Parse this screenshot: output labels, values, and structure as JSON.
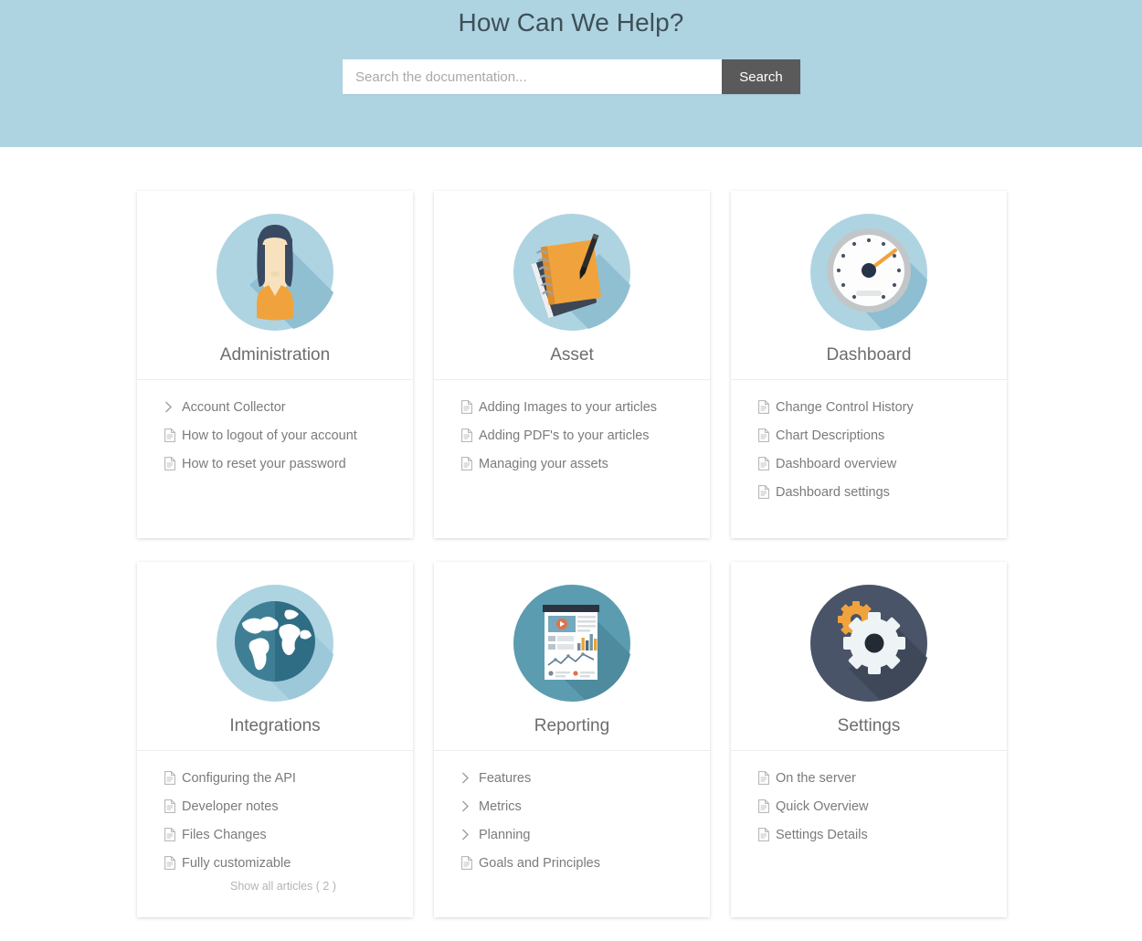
{
  "hero": {
    "title": "How Can We Help?",
    "background_color": "#aed4e2",
    "search": {
      "placeholder": "Search the documentation...",
      "value": "",
      "button_label": "Search",
      "button_color": "#5a5a5a"
    }
  },
  "cards": [
    {
      "title": "Administration",
      "icon": "avatar-person-icon",
      "items": [
        {
          "type": "category",
          "icon": "chevron-right-icon",
          "label": "Account Collector"
        },
        {
          "type": "article",
          "icon": "document-icon",
          "label": "How to logout of your account"
        },
        {
          "type": "article",
          "icon": "document-icon",
          "label": "How to reset your password"
        }
      ],
      "show_all": null
    },
    {
      "title": "Asset",
      "icon": "notebook-pen-icon",
      "items": [
        {
          "type": "article",
          "icon": "document-icon",
          "label": "Adding Images to your articles"
        },
        {
          "type": "article",
          "icon": "document-icon",
          "label": "Adding PDF's to your articles"
        },
        {
          "type": "article",
          "icon": "document-icon",
          "label": "Managing your assets"
        }
      ],
      "show_all": null
    },
    {
      "title": "Dashboard",
      "icon": "gauge-icon",
      "items": [
        {
          "type": "article",
          "icon": "document-icon",
          "label": "Change Control History"
        },
        {
          "type": "article",
          "icon": "document-icon",
          "label": "Chart Descriptions"
        },
        {
          "type": "article",
          "icon": "document-icon",
          "label": "Dashboard overview"
        },
        {
          "type": "article",
          "icon": "document-icon",
          "label": "Dashboard settings"
        }
      ],
      "show_all": null
    },
    {
      "title": "Integrations",
      "icon": "globe-icon",
      "items": [
        {
          "type": "article",
          "icon": "document-icon",
          "label": "Configuring the API"
        },
        {
          "type": "article",
          "icon": "document-icon",
          "label": "Developer notes"
        },
        {
          "type": "article",
          "icon": "document-icon",
          "label": "Files Changes"
        },
        {
          "type": "article",
          "icon": "document-icon",
          "label": "Fully customizable"
        }
      ],
      "show_all": "Show all articles ( 2 )"
    },
    {
      "title": "Reporting",
      "icon": "report-page-icon",
      "items": [
        {
          "type": "category",
          "icon": "chevron-right-icon",
          "label": "Features"
        },
        {
          "type": "category",
          "icon": "chevron-right-icon",
          "label": "Metrics"
        },
        {
          "type": "category",
          "icon": "chevron-right-icon",
          "label": "Planning"
        },
        {
          "type": "article",
          "icon": "document-icon",
          "label": "Goals and Principles"
        }
      ],
      "show_all": null
    },
    {
      "title": "Settings",
      "icon": "gears-icon",
      "items": [
        {
          "type": "article",
          "icon": "document-icon",
          "label": "On the server"
        },
        {
          "type": "article",
          "icon": "document-icon",
          "label": "Quick Overview"
        },
        {
          "type": "article",
          "icon": "document-icon",
          "label": "Settings Details"
        }
      ],
      "show_all": null
    }
  ],
  "colors": {
    "hero_blue": "#aed4e2",
    "icon_circle_light": "#aed4e2",
    "icon_circle_teal": "#5b9cb0",
    "icon_circle_navy": "#4a5468",
    "accent_orange": "#f0a33c",
    "text_gray": "#7b7b7b",
    "title_gray": "#6d6d6d"
  }
}
